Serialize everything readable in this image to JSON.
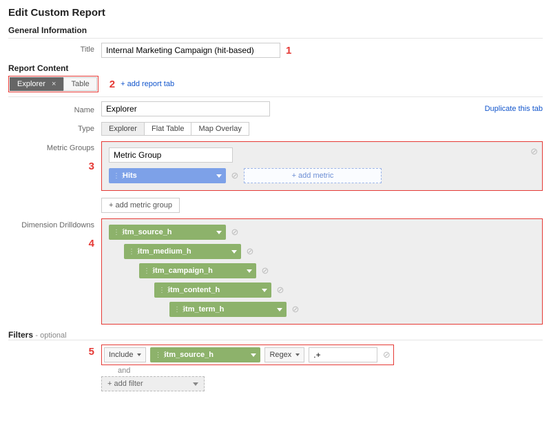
{
  "page_title": "Edit Custom Report",
  "sections": {
    "general_info": "General Information",
    "report_content": "Report Content",
    "filters": "Filters",
    "filters_optional": "- optional"
  },
  "labels": {
    "title": "Title",
    "name": "Name",
    "type": "Type",
    "metric_groups": "Metric Groups",
    "dimension_drilldowns": "Dimension Drilldowns"
  },
  "title_value": "Internal Marketing Campaign (hit-based)",
  "tabs": {
    "items": [
      "Explorer",
      "Table"
    ],
    "active_index": 0,
    "add_label": "+ add report tab"
  },
  "duplicate_label": "Duplicate this tab",
  "name_value": "Explorer",
  "type_options": [
    "Explorer",
    "Flat Table",
    "Map Overlay"
  ],
  "type_selected_index": 0,
  "metric_group": {
    "name": "Metric Group",
    "metrics": [
      "Hits"
    ],
    "add_metric_label": "+ add metric"
  },
  "add_metric_group_label": "+ add metric group",
  "dimension_drilldowns": [
    "itm_source_h",
    "itm_medium_h",
    "itm_campaign_h",
    "itm_content_h",
    "itm_term_h"
  ],
  "filters_row": {
    "include": "Include",
    "dimension": "itm_source_h",
    "match": "Regex",
    "value": ".+",
    "and": "and",
    "add_filter_label": "+ add filter"
  },
  "callouts": {
    "c1": "1",
    "c2": "2",
    "c3": "3",
    "c4": "4",
    "c5": "5"
  }
}
